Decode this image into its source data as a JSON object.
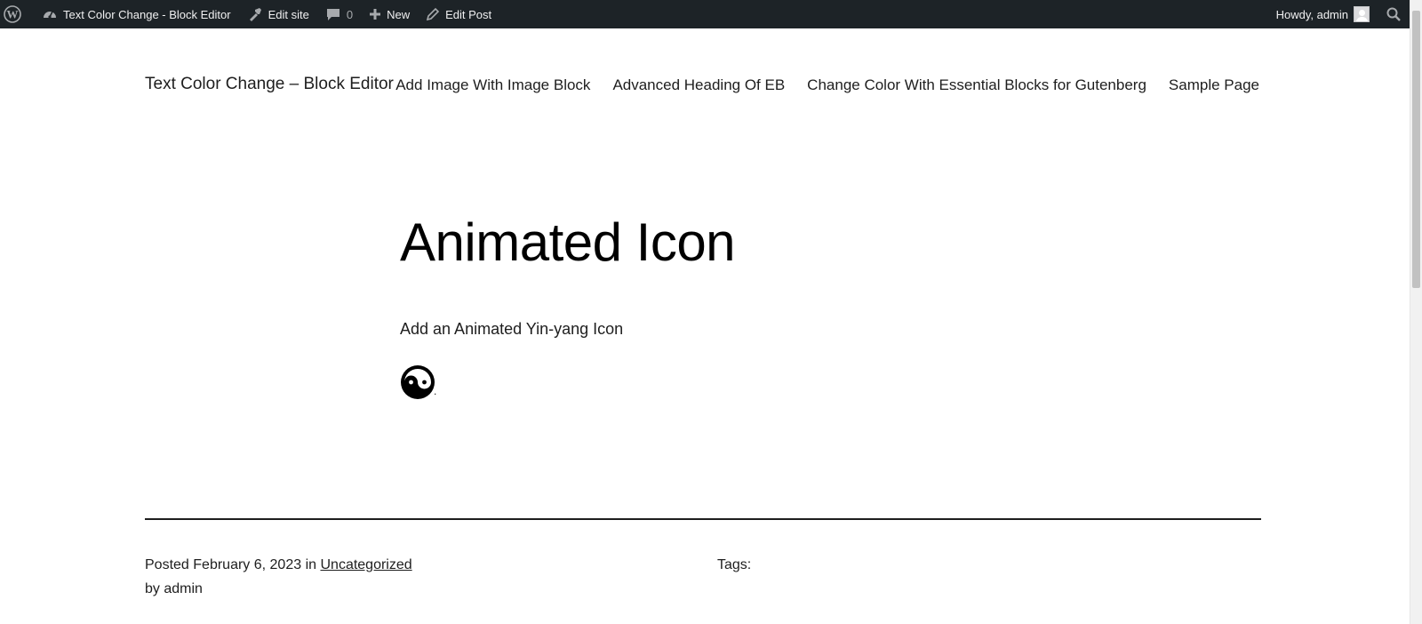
{
  "adminbar": {
    "site_name": "Text Color Change - Block Editor",
    "edit_site": "Edit site",
    "comments_count": "0",
    "new_label": "New",
    "edit_post": "Edit Post",
    "howdy": "Howdy, admin",
    "icons": [
      "wordpress-icon",
      "dashboard-icon",
      "edit-site-icon",
      "comments-icon",
      "plus-icon",
      "pencil-icon",
      "avatar",
      "search-icon"
    ]
  },
  "header": {
    "site_title": "Text Color Change – Block Editor",
    "nav": [
      "Add Image With Image Block",
      "Advanced Heading Of EB",
      "Change Color With Essential Blocks for Gutenberg",
      "Sample Page"
    ]
  },
  "post": {
    "title": "Animated Icon",
    "paragraph": "Add an Animated Yin-yang Icon",
    "icon": "yin-yang-icon",
    "trailing_text": "."
  },
  "meta": {
    "posted_label": "Posted",
    "date": "February 6, 2023",
    "in_label": "in",
    "category": "Uncategorized",
    "by_label": "by",
    "author": "admin",
    "tags_label": "Tags:"
  },
  "colors": {
    "adminbar_bg": "#1d2327",
    "text": "#1e1e1e",
    "background": "#ffffff"
  }
}
